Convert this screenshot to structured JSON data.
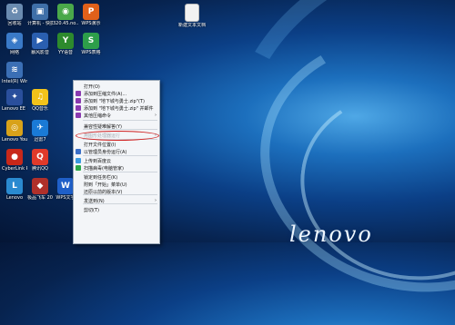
{
  "desktop": {
    "icons": [
      {
        "label": "回收站",
        "icon": "recycle-bin-icon",
        "color": "#6a8bb0",
        "glyph": "♻"
      },
      {
        "label": "计算机 - 快捷方式",
        "icon": "computer-icon",
        "color": "#3f6fa8",
        "glyph": "▣"
      },
      {
        "label": "320.45.no...",
        "icon": "driver-icon",
        "color": "#4aa84a",
        "glyph": "◉"
      },
      {
        "label": "WPS演示",
        "icon": "wps-presentation-icon",
        "color": "#e0601a",
        "glyph": "P"
      },
      {
        "label": "新建文本文档",
        "icon": "text-file-icon",
        "color": "#f2f2f2",
        "glyph": ""
      },
      {
        "label": "网络",
        "icon": "network-icon",
        "color": "#3a7ac8",
        "glyph": "◈"
      },
      {
        "label": "暴风影音",
        "icon": "video-player-icon",
        "color": "#2a5fb0",
        "glyph": "▶"
      },
      {
        "label": "YY语音",
        "icon": "yy-voice-icon",
        "color": "#2d8a2d",
        "glyph": "Y"
      },
      {
        "label": "WPS表格",
        "icon": "wps-spreadsheet-icon",
        "color": "#2d9e4a",
        "glyph": "S"
      },
      {
        "label": "Intel(R) Wirele...",
        "icon": "wireless-icon",
        "color": "#3b6fb5",
        "glyph": "≋"
      },
      {
        "label": "Lenovo EE Boot Op...",
        "icon": "lenovo-boot-icon",
        "color": "#2a4f9c",
        "glyph": "✦"
      },
      {
        "label": "QQ音乐",
        "icon": "qq-music-icon",
        "color": "#f2c21a",
        "glyph": "♫"
      },
      {
        "label": "Lenovo YouCam",
        "icon": "webcam-icon",
        "color": "#d8a21a",
        "glyph": "◎"
      },
      {
        "label": "迅雷7",
        "icon": "thunder-icon",
        "color": "#1a7ad6",
        "glyph": "✈"
      },
      {
        "label": "CyberLink Power2Go",
        "icon": "cyberlink-icon",
        "color": "#c8281a",
        "glyph": "●"
      },
      {
        "label": "腾讯QQ",
        "icon": "qq-icon",
        "color": "#e03a2a",
        "glyph": "Q"
      },
      {
        "label": "Lenovo",
        "icon": "lenovo-app-icon",
        "color": "#2a8ad0",
        "glyph": "L"
      },
      {
        "label": "极品飞车 2012",
        "icon": "game-icon",
        "color": "#b0302a",
        "glyph": "◆"
      },
      {
        "label": "WPS文字",
        "icon": "wps-writer-icon",
        "color": "#1f5fc8",
        "glyph": "W"
      }
    ]
  },
  "context_menu": {
    "items": [
      {
        "label": "打开(O)",
        "icon": "",
        "arrow": false
      },
      {
        "label": "添加到压缩文件(A)...",
        "icon": "archive-icon",
        "arrow": false
      },
      {
        "label": "添加到 \"地下城与勇士.zip\"(T)",
        "icon": "archive-icon",
        "arrow": false
      },
      {
        "label": "添加到 \"地下城与勇士.zip\" 并邮件",
        "icon": "archive-icon",
        "arrow": false
      },
      {
        "label": "其他压缩命令",
        "icon": "archive-icon",
        "arrow": true
      },
      {
        "label": "兼容性疑难解答(Y)",
        "icon": "",
        "arrow": false
      },
      {
        "label": "用图形处理器运行",
        "icon": "",
        "arrow": true
      },
      {
        "label": "打开文件位置(I)",
        "icon": "",
        "arrow": false
      },
      {
        "label": "以管理员身份运行(A)",
        "icon": "shield-icon",
        "arrow": false
      },
      {
        "label": "上传到百度云",
        "icon": "cloud-icon",
        "arrow": false
      },
      {
        "label": "扫描病毒(电脑管家)",
        "icon": "virus-scan-icon",
        "arrow": false
      },
      {
        "label": "锁定到任务栏(K)",
        "icon": "",
        "arrow": false
      },
      {
        "label": "附到「开始」菜单(U)",
        "icon": "",
        "arrow": false
      },
      {
        "label": "还原以前的版本(V)",
        "icon": "",
        "arrow": false
      },
      {
        "label": "发送到(N)",
        "icon": "",
        "arrow": true
      },
      {
        "label": "剪切(T)",
        "icon": "",
        "arrow": false
      }
    ]
  },
  "logo_text": "lenovo"
}
